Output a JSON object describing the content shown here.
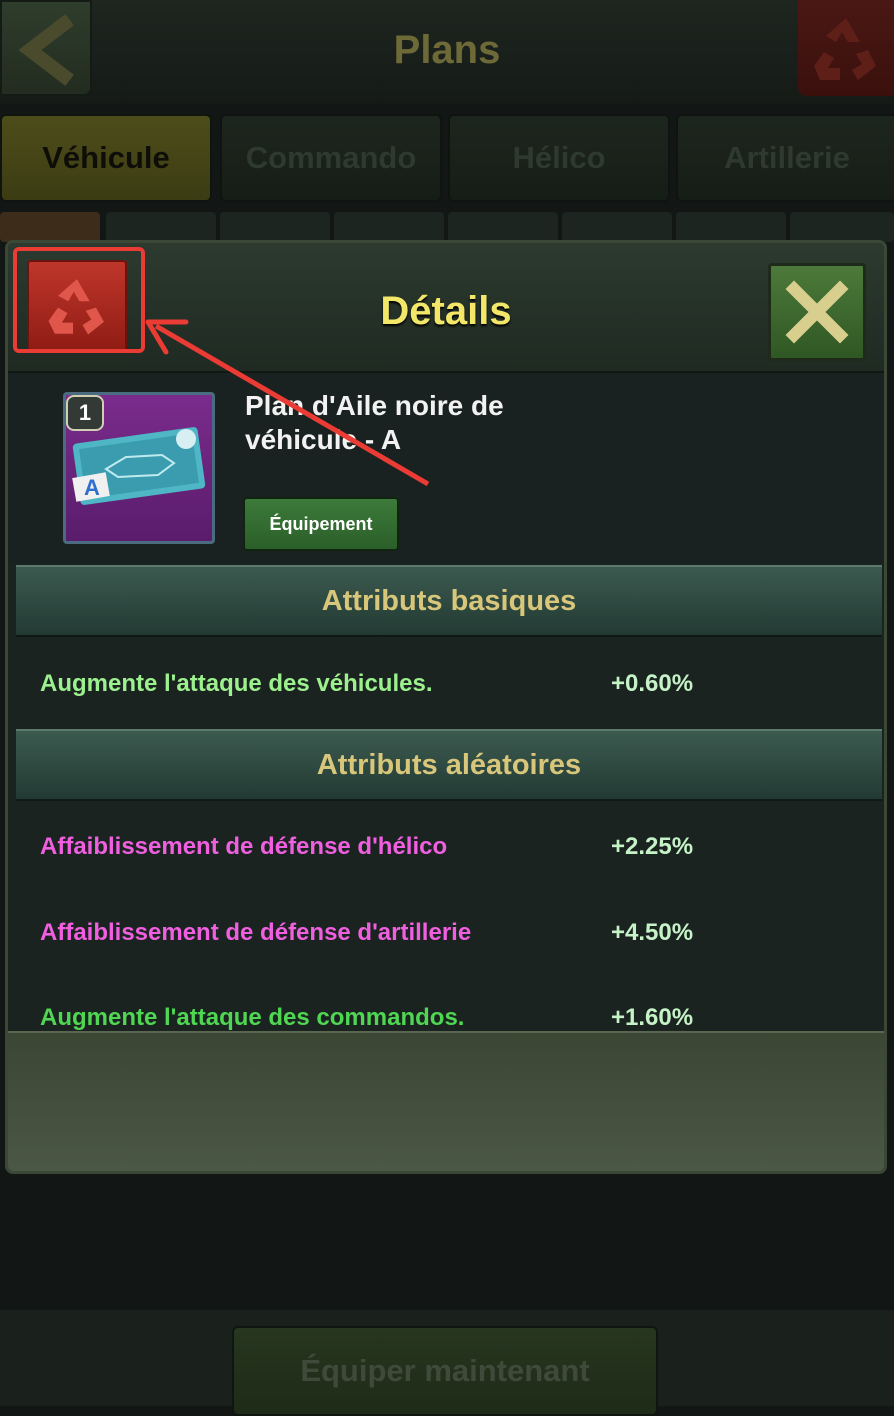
{
  "header": {
    "title": "Plans",
    "back_icon": "chevron-left-icon",
    "recycle_icon": "recycle-icon"
  },
  "tabs": [
    {
      "label": "Véhicule",
      "active": true
    },
    {
      "label": "Commando",
      "active": false
    },
    {
      "label": "Hélico",
      "active": false
    },
    {
      "label": "Artillerie",
      "active": false
    }
  ],
  "modal": {
    "title": "Détails",
    "recycle_icon": "recycle-icon",
    "close_icon": "close-icon",
    "item": {
      "level": "1",
      "name": "Plan d'Aile noire de véhicule - A",
      "category": "Équipement",
      "badge_letter": "A"
    },
    "basic": {
      "header": "Attributs basiques",
      "rows": [
        {
          "label": "Augmente l'attaque des véhicules.",
          "value": "+0.60%",
          "color": "#9cf08e"
        }
      ]
    },
    "random": {
      "header": "Attributs aléatoires",
      "rows": [
        {
          "label": "Affaiblissement de défense d'hélico",
          "value": "+2.25%",
          "color": "#ef5fe0"
        },
        {
          "label": "Affaiblissement de défense d'artillerie",
          "value": "+4.50%",
          "color": "#ef5fe0"
        },
        {
          "label": "Augmente l'attaque des commandos.",
          "value": "+1.60%",
          "color": "#4fd652"
        }
      ]
    }
  },
  "footer": {
    "equip_now": "Équiper maintenant"
  },
  "colors": {
    "accent_title": "#f3e76a",
    "highlight": "#ea3b34",
    "recycle_red": "#c0362b"
  }
}
